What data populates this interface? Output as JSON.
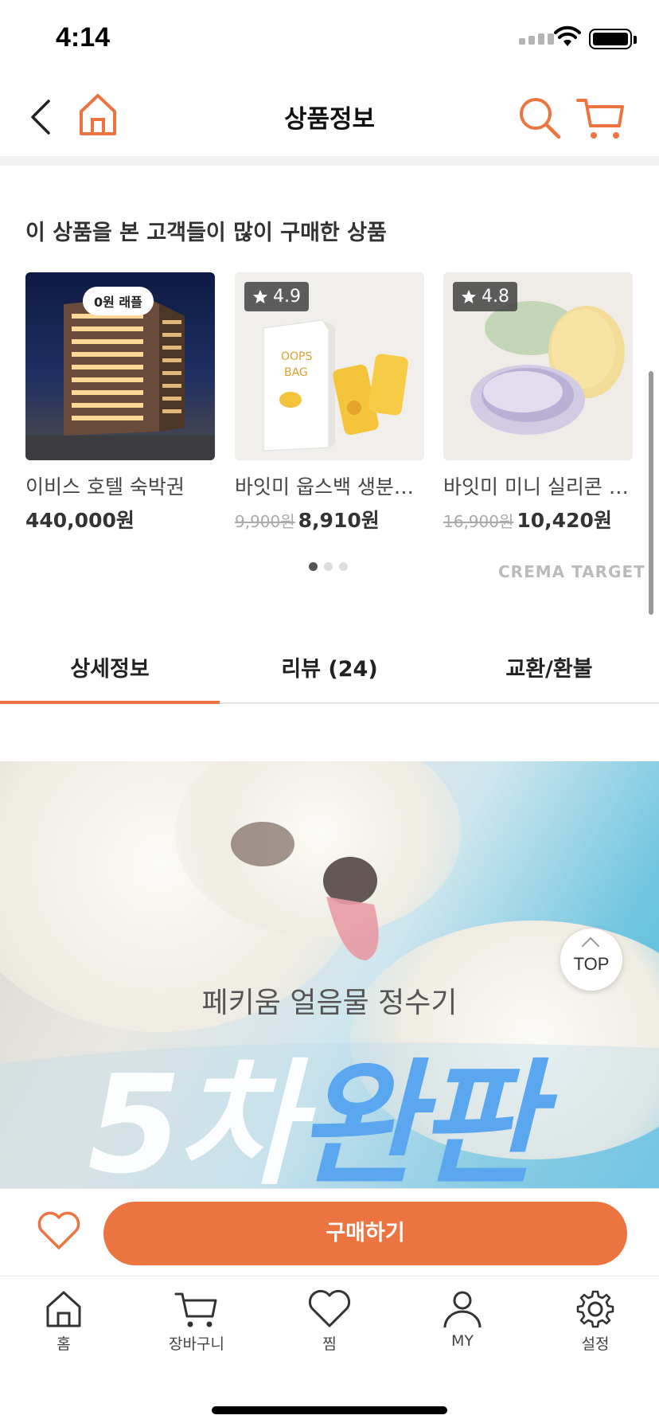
{
  "status": {
    "time": "4:14"
  },
  "nav": {
    "title": "상품정보"
  },
  "recommend": {
    "heading": "이 상품을 본 고객들이 많이 구매한 상품",
    "products": [
      {
        "name": "이비스 호텔 숙박권",
        "price": "440,000원",
        "badge": "0원 래플"
      },
      {
        "name": "바잇미 웁스백 생분…",
        "orig_price": "9,900원",
        "price": "8,910원",
        "rating": "4.9"
      },
      {
        "name": "바잇미 미니 실리콘 …",
        "orig_price": "16,900원",
        "price": "10,420원",
        "rating": "4.8"
      }
    ],
    "brand": "CREMA TARGET"
  },
  "tabs": [
    {
      "label": "상세정보",
      "active": true
    },
    {
      "label": "리뷰 (24)"
    },
    {
      "label": "교환/환불"
    }
  ],
  "banner": {
    "subtitle": "페키움 얼음물 정수기",
    "big_part1": "5차",
    "big_part2": "완판"
  },
  "top_button": {
    "label": "TOP"
  },
  "buy": {
    "label": "구매하기"
  },
  "tabbar": [
    {
      "label": "홈",
      "icon": "home-icon"
    },
    {
      "label": "장바구니",
      "icon": "cart-icon"
    },
    {
      "label": "찜",
      "icon": "heart-icon"
    },
    {
      "label": "MY",
      "icon": "person-icon"
    },
    {
      "label": "설정",
      "icon": "gear-icon"
    }
  ],
  "colors": {
    "accent": "#ec7440",
    "banner_text_blue": "#5aa6ef"
  }
}
